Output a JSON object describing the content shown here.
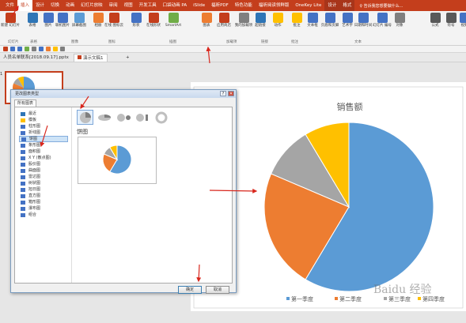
{
  "menu": {
    "tabs": [
      "文件",
      "插入",
      "设计",
      "切换",
      "动画",
      "幻灯片放映",
      "审阅",
      "视图",
      "开发工具",
      "口袋动画 PA",
      "iSlide",
      "福昕PDF",
      "特色功能",
      "福昕阅读领鲜版",
      "OneKey Lite",
      "设计",
      "格式"
    ],
    "active_index": 1,
    "context_indexes": [
      15,
      16
    ],
    "tell_me": "♀ 告诉我您想要做什么..."
  },
  "ribbon": {
    "buttons": [
      {
        "label": "新建\n幻灯片",
        "color": "#c43e1c"
      },
      {
        "label": "表格",
        "color": "#2e75b6"
      },
      {
        "label": "图片",
        "color": "#4472c4"
      },
      {
        "label": "联机图片",
        "color": "#4472c4"
      },
      {
        "label": "屏幕截图",
        "color": "#5b9bd5"
      },
      {
        "label": "相册",
        "color": "#ed7d31"
      },
      {
        "label": "在线\n图标云",
        "color": "#c43e1c"
      },
      {
        "label": "形状",
        "color": "#4472c4"
      },
      {
        "label": "在线形状",
        "color": "#c43e1c"
      },
      {
        "label": "SmartArt",
        "color": "#70ad47"
      },
      {
        "label": "图表",
        "color": "#ed7d31"
      },
      {
        "label": "应用商店",
        "color": "#c43e1c"
      },
      {
        "label": "我的加载项",
        "color": "#7f7f7f"
      },
      {
        "label": "超链接",
        "color": "#2e75b6"
      },
      {
        "label": "动作",
        "color": "#ffc000"
      },
      {
        "label": "批注",
        "color": "#ffc000"
      },
      {
        "label": "文本框",
        "color": "#4472c4"
      },
      {
        "label": "页眉和页脚",
        "color": "#4472c4"
      },
      {
        "label": "艺术字",
        "color": "#4472c4"
      },
      {
        "label": "日期和时间",
        "color": "#4472c4"
      },
      {
        "label": "幻灯片\n编号",
        "color": "#4472c4"
      },
      {
        "label": "对象",
        "color": "#7f7f7f"
      },
      {
        "label": "公式",
        "color": "#595959"
      },
      {
        "label": "符号",
        "color": "#595959"
      },
      {
        "label": "视频",
        "color": "#4472c4"
      }
    ],
    "groups": [
      "幻灯片",
      "表格",
      "图像",
      "图标",
      "插图",
      "加载项",
      "链接",
      "批注",
      "文本"
    ]
  },
  "tabbar": {
    "file_tab": "演示文稿1",
    "other_file": "人员名单联系[2018.09.17].pptx",
    "add": "+"
  },
  "thumbnail": {
    "number": "1"
  },
  "dialog": {
    "title": "更改图表类型",
    "help": "?",
    "close": "✕",
    "tab": "所有图表",
    "categories": [
      {
        "label": "最近",
        "color": "#2e75b6"
      },
      {
        "label": "模板",
        "color": "#ffc000"
      },
      {
        "label": "柱形图",
        "color": "#4472c4"
      },
      {
        "label": "折线图",
        "color": "#4472c4"
      },
      {
        "label": "饼图",
        "color": "#4472c4"
      },
      {
        "label": "条形图",
        "color": "#4472c4"
      },
      {
        "label": "面积图",
        "color": "#4472c4"
      },
      {
        "label": "X Y (散点图)",
        "color": "#4472c4"
      },
      {
        "label": "股价图",
        "color": "#4472c4"
      },
      {
        "label": "曲面图",
        "color": "#4472c4"
      },
      {
        "label": "雷达图",
        "color": "#4472c4"
      },
      {
        "label": "树状图",
        "color": "#4472c4"
      },
      {
        "label": "旭日图",
        "color": "#4472c4"
      },
      {
        "label": "直方图",
        "color": "#4472c4"
      },
      {
        "label": "箱形图",
        "color": "#4472c4"
      },
      {
        "label": "瀑布图",
        "color": "#4472c4"
      },
      {
        "label": "组合",
        "color": "#4472c4"
      }
    ],
    "selected_category": 4,
    "subtype_name": "饼图",
    "ok": "确定",
    "cancel": "取消"
  },
  "chart_data": {
    "type": "pie",
    "title": "销售额",
    "categories": [
      "第一季度",
      "第二季度",
      "第三季度",
      "第四季度"
    ],
    "values": [
      8.2,
      3.2,
      1.4,
      1.2
    ],
    "colors": [
      "#5b9bd5",
      "#ed7d31",
      "#a5a5a5",
      "#ffc000"
    ],
    "legend_position": "bottom"
  },
  "watermark": "Baidu 经验"
}
